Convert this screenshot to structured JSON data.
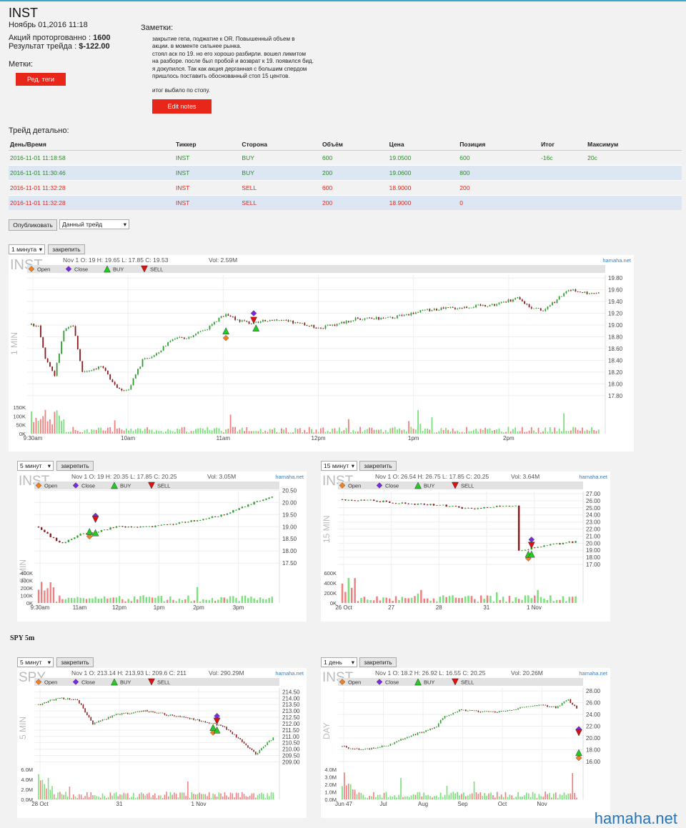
{
  "header": {
    "ticker": "INST",
    "date": "Ноябрь 01,2016 11:18",
    "shares_label": "Акций проторгованно :",
    "shares_value": "1600",
    "result_label": "Результат трейда :",
    "result_value": "$-122.00",
    "tags_label": "Метки:",
    "tags_button": "Ред. теги"
  },
  "notes": {
    "label": "Заметки:",
    "text": "закрытие гепа, поджатие к OR. Повышенный объем в\nакции. в моменте сильнее рынка.\nстоял аск по 19. но его хорошо разбирли. вошел лимитом\nна разборе. после был пробой и возврат к 19. появился бид.\nя докупился. Так как акция дерганная с большим спердом\nпришлось поставить обоснованный стоп 15 центов.",
    "final": "итог выбило по стопу.",
    "edit_button": "Edit notes"
  },
  "trades": {
    "title": "Трейд детально:",
    "columns": [
      "День/Время",
      "Тиккер",
      "Сторона",
      "Объём",
      "Цена",
      "Позиция",
      "Итог",
      "Максимум"
    ],
    "rows": [
      [
        "2016-11-01 11:18:58",
        "INST",
        "BUY",
        "600",
        "19.0500",
        "600",
        "-16c",
        "20c"
      ],
      [
        "2016-11-01 11:30:46",
        "INST",
        "BUY",
        "200",
        "19.0600",
        "800",
        "",
        ""
      ],
      [
        "2016-11-01 11:32:28",
        "INST",
        "SELL",
        "600",
        "18.9000",
        "200",
        "",
        ""
      ],
      [
        "2016-11-01 11:32:28",
        "INST",
        "SELL",
        "200",
        "18.9000",
        "0",
        "",
        ""
      ]
    ]
  },
  "controls": {
    "publish": "Опубликовать",
    "filter": "Данный трейд",
    "pin": "закрепить"
  },
  "spy_label": "SPY 5m",
  "footer": "hamaha.net",
  "colors": {
    "up": "#2f9e2f",
    "down": "#8b1a1a",
    "vol_up": "#7be07b",
    "vol_down": "#f08080",
    "buy_marker": "#22cc22",
    "sell_marker": "#dd1111",
    "open_marker": "#f08020",
    "close_marker": "#7a2adf"
  },
  "chart_data": [
    {
      "id": "c1",
      "type": "candlestick",
      "symbol": "INST",
      "interval": "1 минута",
      "side_label": "1 MIN",
      "info": "Nov 1 O: 19 H: 19.65 L: 17.85 C: 19.53",
      "vol": "Vol: 2.59M",
      "brand": "hamaha.net",
      "legend": [
        "Open",
        "Close",
        "BUY",
        "SELL"
      ],
      "ylim": [
        17.7,
        19.85
      ],
      "yticks": [
        "19.80",
        "19.60",
        "19.40",
        "19.20",
        "19.00",
        "18.80",
        "18.60",
        "18.40",
        "18.20",
        "18.00",
        "17.80"
      ],
      "vticks": [
        "150K",
        "100K",
        "50K",
        "0K"
      ],
      "xticks": [
        "9:30am",
        "10am",
        "11am",
        "12pm",
        "1pm",
        "2pm"
      ],
      "path": [
        [
          0,
          19.0
        ],
        [
          3,
          19.0
        ],
        [
          6,
          18.45
        ],
        [
          10,
          18.15
        ],
        [
          14,
          18.9
        ],
        [
          18,
          19.0
        ],
        [
          22,
          18.2
        ],
        [
          30,
          18.3
        ],
        [
          38,
          17.9
        ],
        [
          42,
          17.9
        ],
        [
          48,
          18.4
        ],
        [
          54,
          18.5
        ],
        [
          60,
          18.75
        ],
        [
          68,
          18.8
        ],
        [
          76,
          18.95
        ],
        [
          84,
          19.2
        ],
        [
          88,
          19.1
        ],
        [
          96,
          19.02
        ],
        [
          104,
          19.1
        ],
        [
          112,
          19.05
        ],
        [
          125,
          18.95
        ],
        [
          140,
          19.1
        ],
        [
          155,
          19.12
        ],
        [
          170,
          19.25
        ],
        [
          185,
          19.3
        ],
        [
          200,
          19.35
        ],
        [
          210,
          19.45
        ],
        [
          216,
          19.3
        ],
        [
          222,
          19.25
        ],
        [
          226,
          19.4
        ],
        [
          232,
          19.6
        ],
        [
          240,
          19.55
        ],
        [
          246,
          19.55
        ]
      ],
      "n": 246,
      "markers": [
        {
          "i": 84,
          "t": "open",
          "p": 18.78
        },
        {
          "i": 84,
          "t": "buy",
          "p": 18.9
        },
        {
          "i": 96,
          "t": "close",
          "p": 19.2
        },
        {
          "i": 96,
          "t": "sell",
          "p": 19.08
        },
        {
          "i": 97,
          "t": "buy",
          "p": 18.95
        }
      ]
    },
    {
      "id": "c2",
      "type": "candlestick",
      "symbol": "INST",
      "interval": "5 минут",
      "side_label": "5 MIN",
      "info": "Nov 1 O: 19 H: 20.35 L: 17.85 C: 20.25",
      "vol": "Vol: 3.05M",
      "brand": "hamaha.net",
      "legend": [
        "Open",
        "Close",
        "BUY",
        "SELL"
      ],
      "ylim": [
        17.3,
        20.45
      ],
      "yticks": [
        "20.50",
        "20.00",
        "19.50",
        "19.00",
        "18.50",
        "18.00",
        "17.50"
      ],
      "vticks": [
        "400K",
        "300K",
        "200K",
        "100K",
        "0K"
      ],
      "xticks": [
        "9:30am",
        "11am",
        "12pm",
        "1pm",
        "2pm",
        "3pm"
      ],
      "path": [
        [
          0,
          19.0
        ],
        [
          4,
          18.6
        ],
        [
          8,
          18.3
        ],
        [
          14,
          18.7
        ],
        [
          20,
          18.8
        ],
        [
          26,
          19.0
        ],
        [
          30,
          19.0
        ],
        [
          36,
          18.98
        ],
        [
          44,
          19.1
        ],
        [
          54,
          19.3
        ],
        [
          62,
          19.5
        ],
        [
          68,
          19.8
        ],
        [
          74,
          20.1
        ],
        [
          79,
          20.25
        ]
      ],
      "n": 79,
      "markers": [
        {
          "i": 17,
          "t": "open",
          "p": 18.6
        },
        {
          "i": 17,
          "t": "buy",
          "p": 18.8
        },
        {
          "i": 19,
          "t": "close",
          "p": 19.45
        },
        {
          "i": 19,
          "t": "sell",
          "p": 19.3
        },
        {
          "i": 19,
          "t": "buy",
          "p": 18.75
        }
      ]
    },
    {
      "id": "c3",
      "type": "candlestick",
      "symbol": "INST",
      "interval": "15 минут",
      "side_label": "15 MIN",
      "info": "Nov 1 O: 26.54 H: 26.75 L: 17.85 C: 20.25",
      "vol": "Vol: 3.64M",
      "brand": "hamaha.net",
      "legend": [
        "Open",
        "Close",
        "BUY",
        "SELL"
      ],
      "ylim": [
        16.5,
        27.3
      ],
      "yticks": [
        "27.00",
        "26.00",
        "25.00",
        "24.00",
        "23.00",
        "22.00",
        "21.00",
        "20.00",
        "19.00",
        "18.00",
        "17.00"
      ],
      "vticks": [
        "600K",
        "400K",
        "200K",
        "0K"
      ],
      "xticks": [
        "26 Oct",
        "27",
        "28",
        "31",
        "1 Nov"
      ],
      "path": [
        [
          0,
          26.2
        ],
        [
          10,
          26.0
        ],
        [
          20,
          25.6
        ],
        [
          30,
          25.4
        ],
        [
          40,
          24.9
        ],
        [
          50,
          25.2
        ],
        [
          55,
          25.4
        ],
        [
          56,
          19.0
        ],
        [
          60,
          19.3
        ],
        [
          70,
          20.0
        ],
        [
          75,
          20.25
        ]
      ],
      "n": 75,
      "markers": [
        {
          "i": 59,
          "t": "open",
          "p": 17.85
        },
        {
          "i": 59,
          "t": "buy",
          "p": 18.45
        },
        {
          "i": 60,
          "t": "close",
          "p": 20.5
        },
        {
          "i": 60,
          "t": "sell",
          "p": 19.7
        },
        {
          "i": 60,
          "t": "buy",
          "p": 18.45
        }
      ]
    },
    {
      "id": "c4",
      "type": "candlestick",
      "symbol": "SPY",
      "interval": "5 минут",
      "side_label": "5 MIN",
      "info": "Nov 1 O: 213.14 H: 213.93 L: 209.6 C: 211",
      "vol": "Vol: 290.29M",
      "brand": "hamaha.net",
      "legend": [
        "Open",
        "Close",
        "BUY",
        "SELL"
      ],
      "ylim": [
        208.8,
        214.8
      ],
      "yticks": [
        "214.50",
        "214.00",
        "213.50",
        "213.00",
        "212.50",
        "212.00",
        "211.50",
        "211.00",
        "210.50",
        "210.00",
        "209.50",
        "209.00"
      ],
      "vticks": [
        "6.0M",
        "4.0M",
        "2.0M",
        "0.0M"
      ],
      "xticks": [
        "28 Oct",
        "31",
        "1 Nov"
      ],
      "path": [
        [
          0,
          213.5
        ],
        [
          10,
          214.0
        ],
        [
          20,
          213.9
        ],
        [
          28,
          212.0
        ],
        [
          40,
          212.7
        ],
        [
          55,
          213.0
        ],
        [
          70,
          212.6
        ],
        [
          82,
          212.3
        ],
        [
          95,
          211.8
        ],
        [
          105,
          210.6
        ],
        [
          112,
          209.6
        ],
        [
          118,
          210.5
        ],
        [
          122,
          211.0
        ]
      ],
      "n": 122,
      "markers": [
        {
          "i": 90,
          "t": "open",
          "p": 211.3
        },
        {
          "i": 90,
          "t": "buy",
          "p": 211.7
        },
        {
          "i": 92,
          "t": "close",
          "p": 212.6
        },
        {
          "i": 92,
          "t": "sell",
          "p": 212.2
        },
        {
          "i": 92,
          "t": "buy",
          "p": 211.5
        }
      ]
    },
    {
      "id": "c5",
      "type": "candlestick",
      "symbol": "INST",
      "interval": "1 день",
      "side_label": "DAY",
      "info": "Nov 1 O: 18.2 H: 26.92 L: 16.55 C: 20.25",
      "vol": "Vol: 20.26M",
      "brand": "hamaha.net",
      "legend": [
        "Open",
        "Close",
        "BUY",
        "SELL"
      ],
      "ylim": [
        15.5,
        28.5
      ],
      "yticks": [
        "28.00",
        "26.00",
        "24.00",
        "22.00",
        "20.00",
        "18.00",
        "16.00"
      ],
      "vticks": [
        "4.0M",
        "3.0M",
        "2.0M",
        "1.0M",
        "0.0M"
      ],
      "xticks": [
        "Jun 47",
        "Jul",
        "Aug",
        "Sep",
        "Oct",
        "Nov"
      ],
      "path": [
        [
          0,
          18.5
        ],
        [
          10,
          18.0
        ],
        [
          22,
          18.7
        ],
        [
          30,
          20.0
        ],
        [
          38,
          21.0
        ],
        [
          45,
          22.0
        ],
        [
          48,
          23.5
        ],
        [
          56,
          24.7
        ],
        [
          64,
          24.5
        ],
        [
          74,
          24.5
        ],
        [
          84,
          25.0
        ],
        [
          94,
          25.6
        ],
        [
          102,
          25.2
        ],
        [
          108,
          26.5
        ],
        [
          112,
          25.0
        ],
        [
          113,
          20.0
        ]
      ],
      "n": 113,
      "markers": [
        {
          "i": 113,
          "t": "open",
          "p": 16.6
        },
        {
          "i": 113,
          "t": "buy",
          "p": 17.5
        },
        {
          "i": 113,
          "t": "close",
          "p": 21.5
        },
        {
          "i": 113,
          "t": "sell",
          "p": 20.9
        }
      ]
    }
  ]
}
